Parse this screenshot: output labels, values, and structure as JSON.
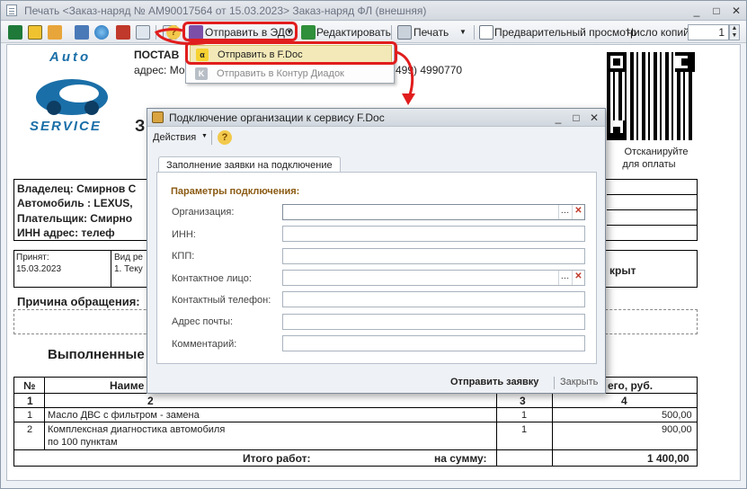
{
  "window": {
    "title": "Печать <Заказ-наряд № AM90017564 от 15.03.2023> Заказ-наряд ФЛ (внешняя)",
    "controls": [
      "_",
      "□",
      "✕"
    ]
  },
  "toolbar": {
    "send_edo": "Отправить в ЭДО",
    "edit": "Редактировать",
    "print": "Печать",
    "preview": "Предварительный просмотр",
    "copies_label": "Число копий",
    "copies_value": "1"
  },
  "dropdown": {
    "items": [
      {
        "label": "Отправить в F.Doc",
        "icon": "fdoc-icon"
      },
      {
        "label": "Отправить в Контур Диадок",
        "icon": "diadoc-icon"
      }
    ]
  },
  "document": {
    "logo_top": "Auto",
    "logo_bottom": "SERVICE",
    "header_line1": "ПОСТАВ",
    "header_line2": "адрес: Мо",
    "phone_tail": "499) 4990770",
    "big_letter": "З",
    "qr_caption_1": "Отсканируйте",
    "qr_caption_2": "для оплаты",
    "owner": "Владелец: Смирнов С",
    "car": "Автомобиль : LEXUS,",
    "payer": "Плательщик:  Смирно",
    "inn": "ИНН    адрес:   телеф",
    "accepted_label": "Принят:",
    "accepted_date": "15.03.2023",
    "repair_label": "Вид ре",
    "repair_value": "1. Теку",
    "closed": "крыт",
    "reason": "Причина обращения:",
    "done": "Выполненные",
    "table": {
      "h_no": "№",
      "h_name": "Наиме",
      "h_sum": "его, руб.",
      "n1": "1",
      "n2": "2",
      "n3": "3",
      "n4": "4",
      "rows": [
        {
          "no": "1",
          "name": "Масло ДВС с фильтром - замена",
          "qty": "1",
          "sum": "500,00"
        },
        {
          "no": "2",
          "name": "Комплексная диагностика автомобиля",
          "name2": "по 100 пунктам",
          "qty": "1",
          "sum": "900,00"
        }
      ],
      "total_label": "Итого работ:",
      "total_sum_label": "на сумму:",
      "total": "1 400,00"
    }
  },
  "dialog": {
    "title": "Подключение организации к сервису F.Doc",
    "actions": "Действия",
    "tab": "Заполнение заявки на подключение",
    "section": "Параметры подключения:",
    "fields": [
      {
        "label": "Организация:",
        "value": ""
      },
      {
        "label": "ИНН:",
        "value": ""
      },
      {
        "label": "КПП:",
        "value": ""
      },
      {
        "label": "Контактное лицо:",
        "value": ""
      },
      {
        "label": "Контактный телефон:",
        "value": ""
      },
      {
        "label": "Адрес почты:",
        "value": ""
      },
      {
        "label": "Комментарий:",
        "value": ""
      }
    ],
    "submit": "Отправить заявку",
    "close": "Закрыть"
  },
  "colors": {
    "highlight": "#e11d1d",
    "section": "#8a5a12",
    "logo": "#1a6fa8"
  }
}
